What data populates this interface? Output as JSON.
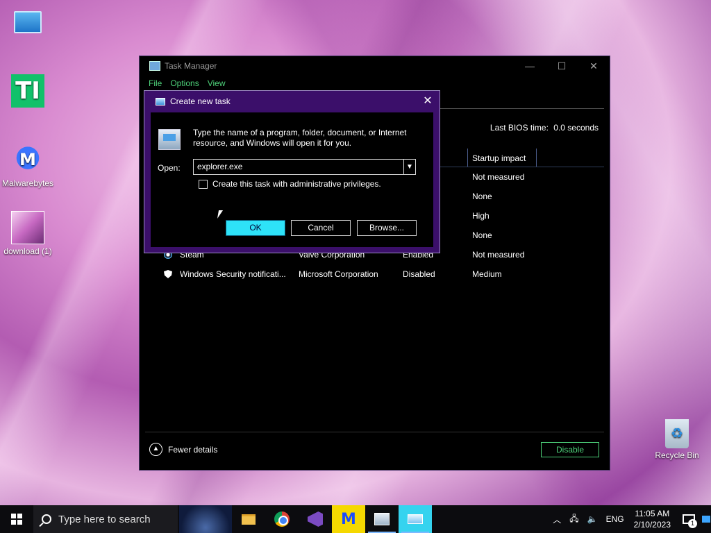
{
  "desktop": {
    "icons": [
      {
        "name": "this-pc",
        "label": ""
      },
      {
        "name": "ti",
        "label": "TI"
      },
      {
        "name": "malwarebytes",
        "label": "Malwarebytes"
      },
      {
        "name": "download",
        "label": "download (1)"
      },
      {
        "name": "recycle-bin",
        "label": "Recycle Bin"
      }
    ]
  },
  "task_manager": {
    "title": "Task Manager",
    "menu": [
      "File",
      "Options",
      "View"
    ],
    "bios_label": "Last BIOS time:",
    "bios_value": "0.0 seconds",
    "column_header": "Startup impact",
    "rows": [
      {
        "name": "",
        "publisher": "",
        "status": "",
        "impact": "Not measured"
      },
      {
        "name": "",
        "publisher": "",
        "status": "",
        "impact": "None"
      },
      {
        "name": "",
        "publisher": "",
        "status": "",
        "impact": "High"
      },
      {
        "name": "",
        "publisher": "",
        "status": "",
        "impact": "None"
      },
      {
        "name": "Steam",
        "publisher": "Valve Corporation",
        "status": "Enabled",
        "impact": "Not measured"
      },
      {
        "name": "Windows Security notificati...",
        "publisher": "Microsoft Corporation",
        "status": "Disabled",
        "impact": "Medium"
      }
    ],
    "fewer_details": "Fewer details",
    "disable_button": "Disable",
    "accent_color": "#4ed27a"
  },
  "dialog": {
    "title": "Create new task",
    "message": "Type the name of a program, folder, document, or Internet resource, and Windows will open it for you.",
    "open_label": "Open:",
    "open_value": "explorer.exe",
    "admin_checkbox_label": "Create this task with administrative privileges.",
    "admin_checked": false,
    "ok": "OK",
    "cancel": "Cancel",
    "browse": "Browse...",
    "ok_color": "#2ee2f8",
    "frame_color": "#3b0f6a"
  },
  "taskbar": {
    "search_placeholder": "Type here to search",
    "language": "ENG",
    "time": "11:05 AM",
    "date": "2/10/2023",
    "notification_count": "1"
  }
}
